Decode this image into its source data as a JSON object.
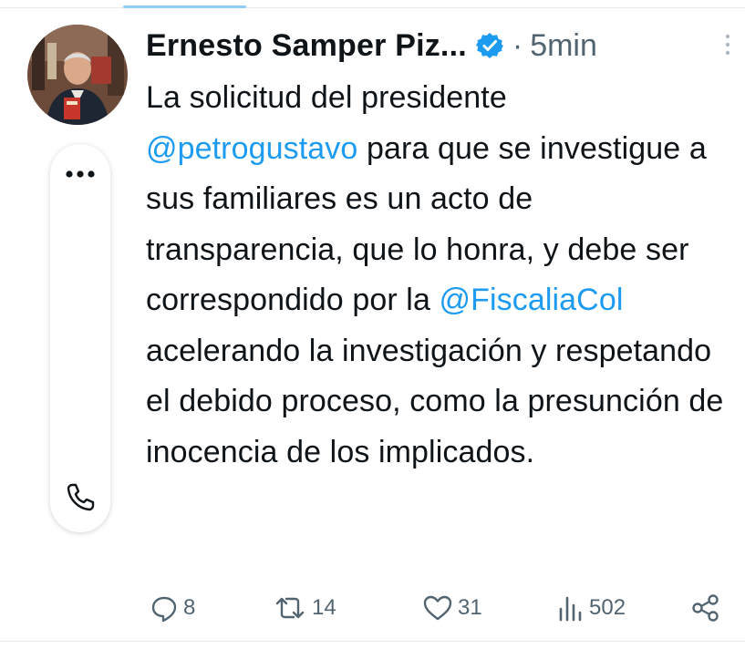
{
  "tweet": {
    "author_name": "Ernesto Samper Piz...",
    "separator": "·",
    "time": "5min",
    "text_parts": [
      "La solicitud del presidente",
      "@petrogustavo",
      " para que se investigue a sus familiares es un acto de transparencia, que lo honra, y debe ser correspondido por la ",
      "@FiscaliaCol",
      " acelerando la investigación y respetando el debido proceso, como la presunción de inocencia de los implicados."
    ]
  },
  "actions": {
    "replies": "8",
    "retweets": "14",
    "likes": "31",
    "views": "502"
  },
  "colors": {
    "accent": "#1d9bf0",
    "muted": "#536471",
    "text": "#0f1419"
  },
  "icons": [
    "verified-badge-icon",
    "more-vertical-icon",
    "more-horizontal-icon",
    "phone-icon",
    "reply-icon",
    "retweet-icon",
    "like-icon",
    "views-icon",
    "share-icon"
  ]
}
